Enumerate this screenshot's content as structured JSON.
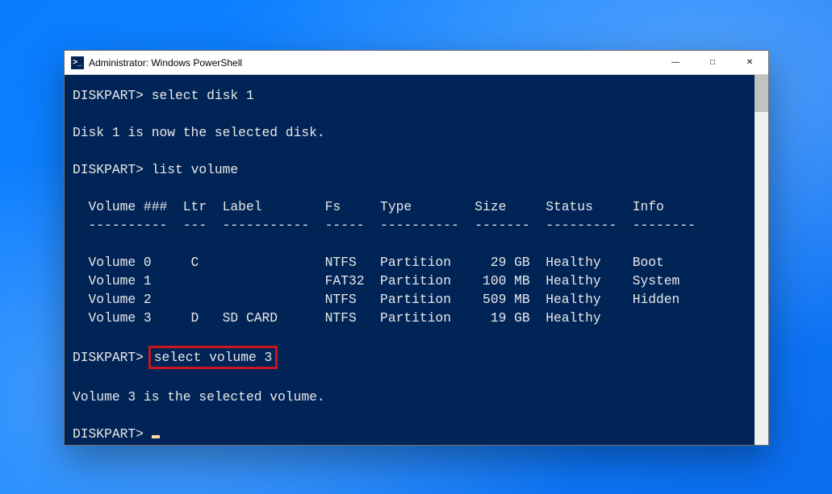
{
  "window": {
    "icon_text": ">_",
    "title": "Administrator: Windows PowerShell",
    "buttons": {
      "min": "—",
      "max": "□",
      "close": "✕"
    }
  },
  "term": {
    "p1_prompt": "DISKPART>",
    "p1_cmd": "select disk 1",
    "r1": "Disk 1 is now the selected disk.",
    "p2_prompt": "DISKPART>",
    "p2_cmd": "list volume",
    "hdr": "  Volume ###  Ltr  Label        Fs     Type        Size     Status     Info",
    "sep": "  ----------  ---  -----------  -----  ----------  -------  ---------  --------",
    "row0": "  Volume 0     C                NTFS   Partition     29 GB  Healthy    Boot",
    "row1": "  Volume 1                      FAT32  Partition    100 MB  Healthy    System",
    "row2": "  Volume 2                      NTFS   Partition    509 MB  Healthy    Hidden",
    "row3": "  Volume 3     D   SD CARD      NTFS   Partition     19 GB  Healthy",
    "p3_prompt": "DISKPART>",
    "p3_cmd": "select volume 3",
    "r3": "Volume 3 is the selected volume.",
    "p4_prompt": "DISKPART>"
  },
  "volumes": [
    {
      "num": 0,
      "ltr": "C",
      "label": "",
      "fs": "NTFS",
      "type": "Partition",
      "size": "29 GB",
      "status": "Healthy",
      "info": "Boot"
    },
    {
      "num": 1,
      "ltr": "",
      "label": "",
      "fs": "FAT32",
      "type": "Partition",
      "size": "100 MB",
      "status": "Healthy",
      "info": "System"
    },
    {
      "num": 2,
      "ltr": "",
      "label": "",
      "fs": "NTFS",
      "type": "Partition",
      "size": "509 MB",
      "status": "Healthy",
      "info": "Hidden"
    },
    {
      "num": 3,
      "ltr": "D",
      "label": "SD CARD",
      "fs": "NTFS",
      "type": "Partition",
      "size": "19 GB",
      "status": "Healthy",
      "info": ""
    }
  ],
  "highlight": "select volume 3"
}
